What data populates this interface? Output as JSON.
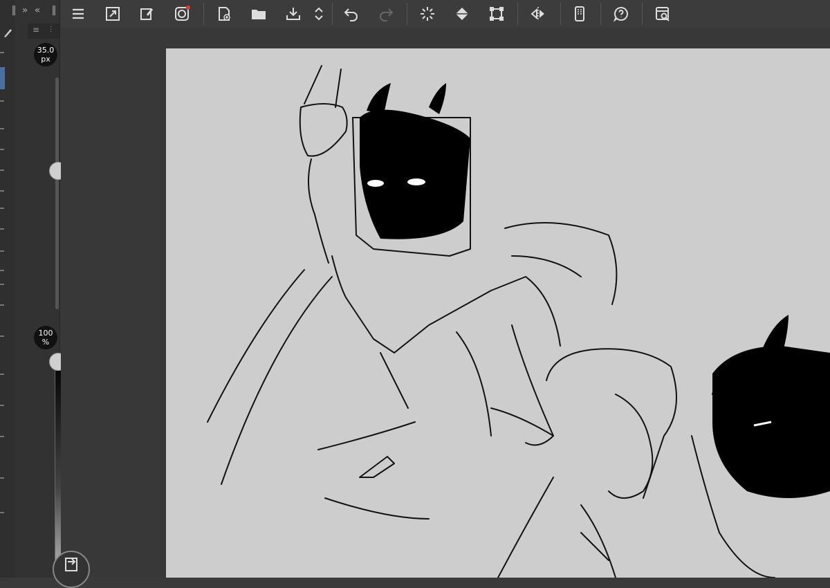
{
  "brush_panel": {
    "size_value": "35.0",
    "size_unit": "px",
    "size_fraction": 0.6,
    "opacity_value": "100",
    "opacity_unit": "%",
    "opacity_fraction": 1.0
  },
  "toolbar": {
    "icons": [
      "menu-icon",
      "fullscreen-icon",
      "eyedropper-settings-icon",
      "companion-app-icon",
      "new-file-icon",
      "open-folder-icon",
      "save-icon",
      "expand-chevrons-icon",
      "undo-icon",
      "redo-icon",
      "loading-spinner-icon",
      "fill-bucket-icon",
      "transform-icon",
      "flip-horizontal-icon",
      "smartphone-icon",
      "help-icon",
      "quick-access-icon"
    ],
    "notification_color": "#e23a3a"
  },
  "canvas": {
    "background": "#cdcdcd",
    "content": "sketch-illustration"
  },
  "colors": {
    "panel_bg": "#323232",
    "toolbar_bg": "#3c3c3c",
    "active_accent": "#4a6fa5"
  }
}
